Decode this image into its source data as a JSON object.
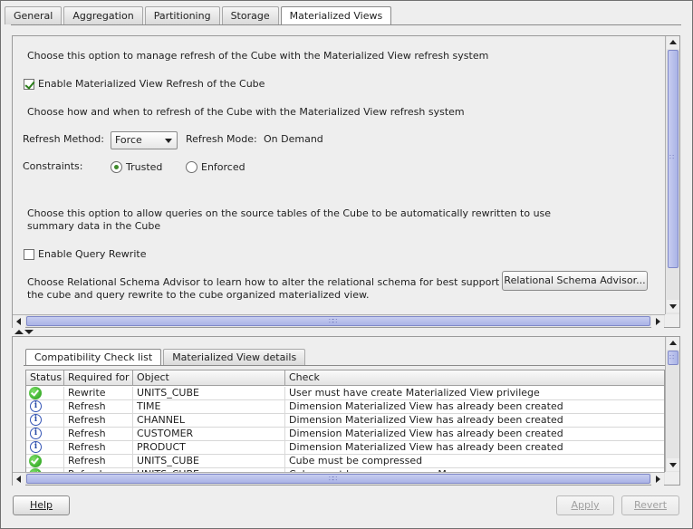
{
  "tabs": [
    {
      "label": "General",
      "active": false
    },
    {
      "label": "Aggregation",
      "active": false
    },
    {
      "label": "Partitioning",
      "active": false
    },
    {
      "label": "Storage",
      "active": false
    },
    {
      "label": "Materialized Views",
      "active": true
    }
  ],
  "mv": {
    "intro": "Choose this option to manage refresh of the Cube with the Materialized View refresh system",
    "enable_label": "Enable Materialized View Refresh of the Cube",
    "enable_checked": true,
    "how_when": "Choose how and when to refresh of the Cube with the Materialized View refresh system",
    "refresh_method_label": "Refresh Method:",
    "refresh_method_value": "Force",
    "refresh_mode_label": "Refresh Mode:",
    "refresh_mode_value": "On Demand",
    "constraints_label": "Constraints:",
    "constraint_options": [
      {
        "label": "Trusted",
        "selected": true
      },
      {
        "label": "Enforced",
        "selected": false
      }
    ],
    "rewrite_intro_1": "Choose this option to allow queries on the source tables of the Cube to be automatically rewritten to use",
    "rewrite_intro_2": "summary data in the Cube",
    "query_rewrite_label": "Enable Query Rewrite",
    "query_rewrite_checked": false,
    "advisor_text_1": "Choose Relational Schema Advisor to learn how to alter the relational schema for best support o",
    "advisor_text_2": "the cube and query rewrite to the cube organized materialized view.",
    "advisor_button": "Relational Schema Advisor..."
  },
  "sub_tabs": [
    {
      "label": "Compatibility Check list",
      "active": true
    },
    {
      "label": "Materialized View details",
      "active": false
    }
  ],
  "table": {
    "columns": [
      "Status",
      "Required for",
      "Object",
      "Check"
    ],
    "rows": [
      {
        "status": "ok",
        "required": "Rewrite",
        "object": "UNITS_CUBE",
        "check": "User must have create Materialized View privilege"
      },
      {
        "status": "info",
        "required": "Refresh",
        "object": "TIME",
        "check": "Dimension Materialized View has already been created"
      },
      {
        "status": "info",
        "required": "Refresh",
        "object": "CHANNEL",
        "check": "Dimension Materialized View has already been created"
      },
      {
        "status": "info",
        "required": "Refresh",
        "object": "CUSTOMER",
        "check": "Dimension Materialized View has already been created"
      },
      {
        "status": "info",
        "required": "Refresh",
        "object": "PRODUCT",
        "check": "Dimension Materialized View has already been created"
      },
      {
        "status": "ok",
        "required": "Refresh",
        "object": "UNITS_CUBE",
        "check": "Cube must be compressed"
      },
      {
        "status": "ok",
        "required": "Refresh",
        "object": "UNITS_CUBE",
        "check": "Cube must have one or more Measures"
      }
    ]
  },
  "footer": {
    "help": "Help",
    "apply": "Apply",
    "revert": "Revert"
  },
  "colors": {
    "scroll_thumb": "#aab3e6",
    "ok_green": "#1f9a12",
    "info_blue": "#2b4ea8"
  }
}
